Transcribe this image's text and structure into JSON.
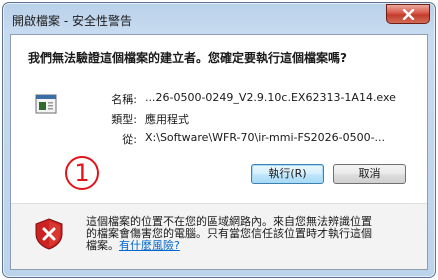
{
  "window": {
    "title": "開啟檔案 - 安全性警告"
  },
  "dialog": {
    "heading": "我們無法驗證這個檔案的建立者。您確定要執行這個檔案嗎?",
    "name_label": "名稱:",
    "name_value": "...26-0500-0249_V2.9.10c.EX62313-1A14.exe",
    "type_label": "類型:",
    "type_value": "應用程式",
    "from_label": "從:",
    "from_value": "X:\\Software\\WFR-70\\ir-mmi-FS2026-0500-...",
    "annotation": "1",
    "run_button": "執行(R)",
    "cancel_button": "取消"
  },
  "warning": {
    "line1": "這個檔案的位置不在您的區域網路內。來自您無法辨識位置",
    "line2": "的檔案會傷害您的電腦。只有當您信任該位置時才執行這個",
    "line3_prefix": "檔案。",
    "help_link": "有什麼風險?"
  },
  "colors": {
    "annotation_red": "#e2141b",
    "link_blue": "#0066cc",
    "shield_red": "#cc2222"
  },
  "icons": {
    "close": "close-icon",
    "file": "application-file-icon",
    "shield": "security-shield-icon"
  }
}
